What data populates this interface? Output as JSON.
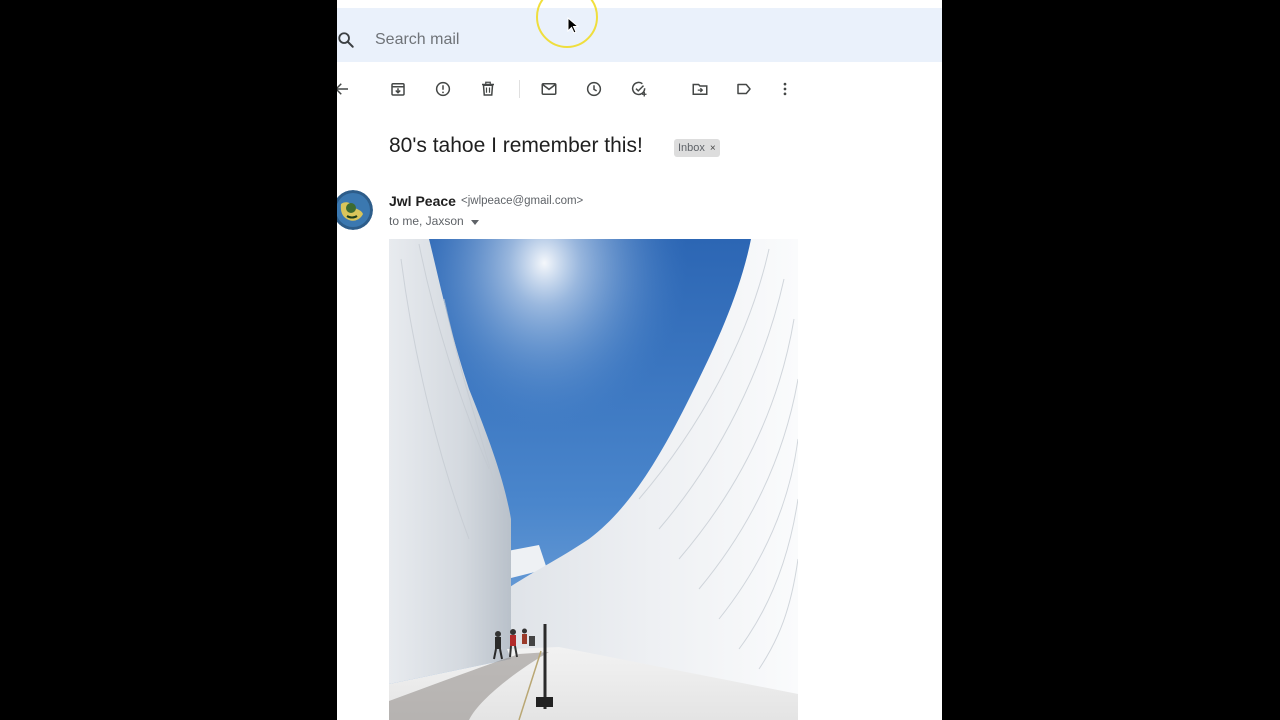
{
  "search": {
    "placeholder": "Search mail",
    "icon": "search-icon"
  },
  "toolbar": {
    "items": [
      {
        "name": "back",
        "icon": "arrow-left-icon"
      },
      {
        "name": "archive",
        "icon": "archive-icon"
      },
      {
        "name": "report-spam",
        "icon": "report-icon"
      },
      {
        "name": "delete",
        "icon": "trash-icon"
      },
      {
        "name": "mark-unread",
        "icon": "mail-icon"
      },
      {
        "name": "snooze",
        "icon": "clock-icon"
      },
      {
        "name": "add-task",
        "icon": "task-add-icon"
      },
      {
        "name": "move-to",
        "icon": "folder-move-icon"
      },
      {
        "name": "labels",
        "icon": "label-icon"
      },
      {
        "name": "more",
        "icon": "more-vert-icon"
      }
    ]
  },
  "email": {
    "subject": "80's tahoe I remember this!",
    "label": "Inbox",
    "label_close": "×",
    "sender_name": "Jwl Peace",
    "sender_email": "<jwlpeace@gmail.com>",
    "recipients": "to me, Jaxson"
  },
  "colors": {
    "search_bg": "#eaf1fb",
    "background": "#ffffff",
    "outer": "#000000",
    "chip_bg": "#dddddd",
    "cursor_highlight": "#f0dc28"
  }
}
